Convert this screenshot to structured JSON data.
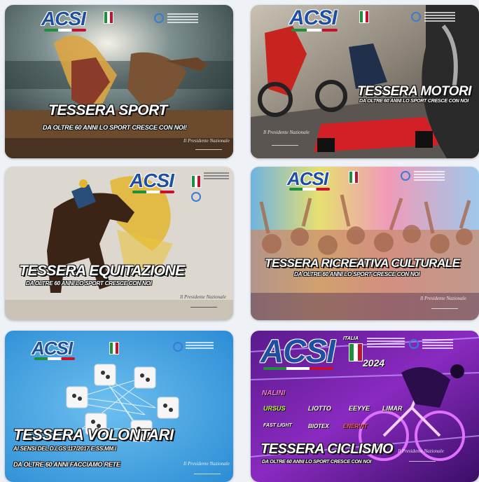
{
  "brand": {
    "logo": "ACSI"
  },
  "cards": [
    {
      "title": "TESSERA SPORT",
      "subtitle": "DA OLTRE 60 ANNI LO SPORT CRESCE CON NOI!",
      "signature": "Il Presidente Nazionale"
    },
    {
      "title": "TESSERA MOTORI",
      "subtitle": "DA OLTRE 60 ANNI LO SPORT CRESCE CON NOI",
      "signature": "Il Presidente Nazionale"
    },
    {
      "title": "TESSERA EQUITAZIONE",
      "subtitle": "DA OLTRE 60 ANNI LO SPORT CRESCE CON NOI",
      "signature": "Il Presidente Nazionale"
    },
    {
      "title": "TESSERA RICREATIVA CULTURALE",
      "subtitle": "DA OLTRE 60 ANNI LO SPORT CRESCE CON NOI",
      "signature": "Il Presidente Nazionale"
    },
    {
      "title": "TESSERA VOLONTARI",
      "subtitle": "AI SENSI DEL D.LGS 117/2017 E SS.MM.I",
      "subtitle2": "DA OLTRE 60 ANNI FACCIAMO RETE",
      "signature": "Il Presidente Nazionale"
    },
    {
      "title": "TESSERA CICLISMO",
      "subtitle": "DA OLTRE 60 ANNI LO SPORT CRESCE CON NOI",
      "signature": "Il Presidente Nazionale",
      "year": "2024",
      "flag_label": "ITALIA",
      "sponsors": [
        "NALINI",
        "URSUS",
        "LIOTTO",
        "EEYYE",
        "LIMAR",
        "FAST LIGHT",
        "BIOTEX",
        "ENERVIT"
      ]
    }
  ]
}
